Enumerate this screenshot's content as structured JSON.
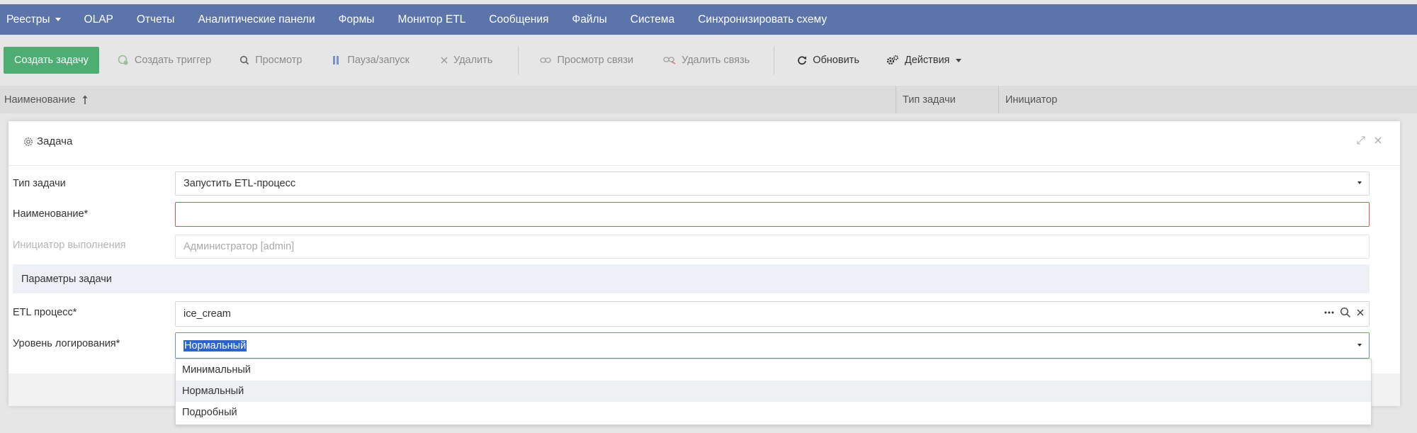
{
  "menu": {
    "items": [
      "Реестры",
      "OLAP",
      "Отчеты",
      "Аналитические панели",
      "Формы",
      "Монитор ETL",
      "Сообщения",
      "Файлы",
      "Система",
      "Синхронизировать схему"
    ]
  },
  "toolbar": {
    "create_task": "Создать задачу",
    "create_trigger": "Создать триггер",
    "view": "Просмотр",
    "pause_start": "Пауза/запуск",
    "delete": "Удалить",
    "view_link": "Просмотр связи",
    "delete_link": "Удалить связь",
    "refresh": "Обновить",
    "actions": "Действия"
  },
  "grid": {
    "columns": [
      "Наименование",
      "Тип задачи",
      "Инициатор"
    ]
  },
  "dialog": {
    "title": "Задача",
    "task_type_label": "Тип задачи",
    "task_type_value": "Запустить ETL-процесс",
    "name_label": "Наименование*",
    "name_value": "",
    "initiator_label": "Инициатор выполнения",
    "initiator_placeholder": "Администратор [admin]",
    "section_title": "Параметры задачи",
    "etl_label": "ETL процесс*",
    "etl_value": "ice_cream",
    "log_label": "Уровень логирования*",
    "log_value": "Нормальный"
  },
  "dropdown": {
    "options": [
      "Минимальный",
      "Нормальный",
      "Подробный"
    ],
    "highlighted_index": 1
  },
  "colors": {
    "menu_bg": "#5b75ab",
    "primary_button": "#4dae72",
    "error_border": "#d9534f",
    "selection": "#2a63d4"
  }
}
